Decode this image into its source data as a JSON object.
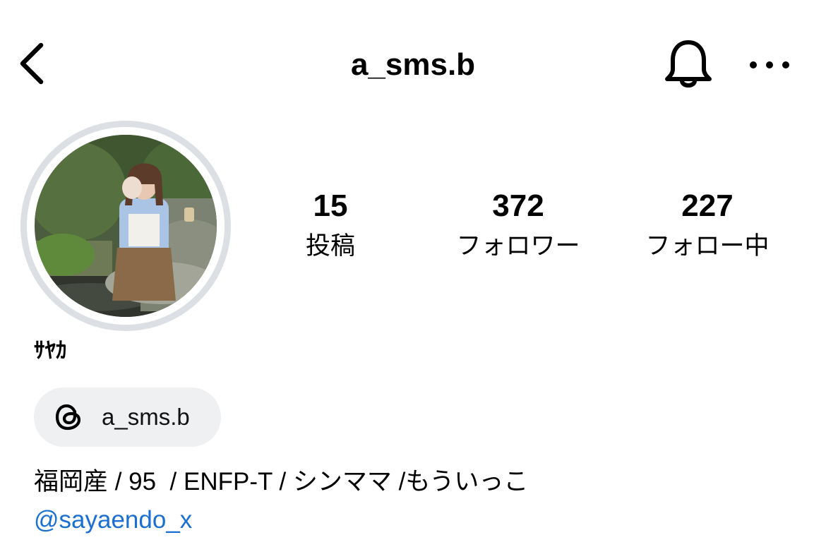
{
  "header": {
    "username": "a_sms.b",
    "back_icon": "chevron-left-icon",
    "bell_icon": "bell-icon",
    "more_icon": "more-horizontal-icon"
  },
  "profile": {
    "display_name": "ｻﾔｶ",
    "avatar": "profile-photo-avatar"
  },
  "stats": [
    {
      "value": "15",
      "label": "投稿"
    },
    {
      "value": "372",
      "label": "フォロワー"
    },
    {
      "value": "227",
      "label": "フォロー中"
    }
  ],
  "threads": {
    "icon": "threads-icon",
    "handle": "a_sms.b"
  },
  "bio": {
    "text": "福岡産 / 95  / ENFP-T / シンママ /もういっこ",
    "link": "@sayaendo_x"
  },
  "colors": {
    "link": "#1a6fd1",
    "chip_bg": "#eff0f2",
    "avatar_ring": "#dcdfe4"
  }
}
